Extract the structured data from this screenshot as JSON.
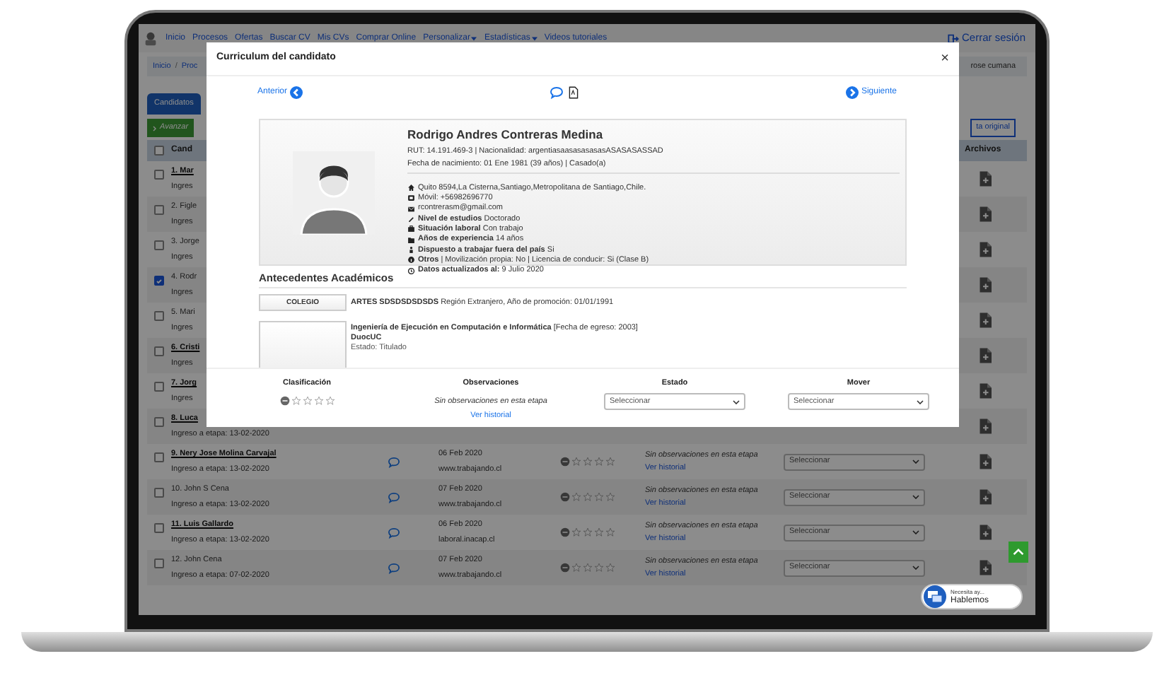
{
  "nav": {
    "items": [
      {
        "label": "Inicio",
        "caret": false
      },
      {
        "label": "Procesos",
        "caret": false
      },
      {
        "label": "Ofertas",
        "caret": false
      },
      {
        "label": "Buscar CV",
        "caret": false
      },
      {
        "label": "Mis CVs",
        "caret": false
      },
      {
        "label": "Comprar Online",
        "caret": false
      },
      {
        "label": "Personalizar",
        "caret": true
      },
      {
        "label": "Estadísticas",
        "caret": true
      },
      {
        "label": "Videos tutoriales",
        "caret": false
      }
    ],
    "logout": "Cerrar sesión"
  },
  "breadcrumb": {
    "items": [
      "Inicio",
      "Proc"
    ],
    "separator": "/",
    "user": "rose cumana"
  },
  "tabs": [
    {
      "label": "Candidatos",
      "selected": true
    }
  ],
  "advance_button": "Avanzar",
  "view_button": "ta original",
  "table": {
    "columns": [
      "Cand",
      "Archivos"
    ],
    "header_checked": false,
    "rows": [
      {
        "name": "1. Mar",
        "emphasized": true,
        "checked": false,
        "entry": "Ingres"
      },
      {
        "name": "2. Figle",
        "emphasized": false,
        "checked": false,
        "entry": "Ingres"
      },
      {
        "name": "3. Jorge",
        "emphasized": false,
        "checked": false,
        "entry": "Ingres"
      },
      {
        "name": "4. Rodr",
        "emphasized": false,
        "checked": true,
        "entry": "Ingres"
      },
      {
        "name": "5. Mari",
        "emphasized": false,
        "checked": false,
        "entry": "Ingres"
      },
      {
        "name": "6. Cristi",
        "emphasized": true,
        "checked": false,
        "entry": "Ingres"
      },
      {
        "name": "7. Jorg",
        "emphasized": true,
        "checked": false,
        "entry": "Ingres"
      },
      {
        "name": "8. Luca",
        "emphasized": true,
        "checked": false,
        "entry": "Ingreso a etapa: 13-02-2020"
      },
      {
        "name": "9. Nery Jose Molina Carvajal",
        "emphasized": true,
        "checked": false,
        "entry": "Ingreso a etapa: 13-02-2020",
        "date": "06 Feb 2020",
        "site": "www.trabajando.cl",
        "stars": 0,
        "observation": "Sin observaciones en esta etapa",
        "history_link": "Ver historial",
        "status": "Seleccionar"
      },
      {
        "name": "10. John S Cena",
        "emphasized": false,
        "checked": false,
        "entry": "Ingreso a etapa: 13-02-2020",
        "date": "07 Feb 2020",
        "site": "www.trabajando.cl",
        "stars": 0,
        "observation": "Sin observaciones en esta etapa",
        "history_link": "Ver historial",
        "status": "Seleccionar"
      },
      {
        "name": "11. Luis Gallardo",
        "emphasized": true,
        "checked": false,
        "entry": "Ingreso a etapa: 13-02-2020",
        "date": "06 Feb 2020",
        "site": "laboral.inacap.cl",
        "stars": 0,
        "observation": "Sin observaciones en esta etapa",
        "history_link": "Ver historial",
        "status": "Seleccionar"
      },
      {
        "name": "12. John Cena",
        "emphasized": false,
        "checked": false,
        "entry": "Ingreso a etapa: 07-02-2020",
        "date": "07 Feb 2020",
        "site": "www.trabajando.cl",
        "stars": 0,
        "observation": "Sin observaciones en esta etapa",
        "history_link": "Ver historial",
        "status": "Seleccionar"
      }
    ]
  },
  "modal": {
    "title": "Curriculum del candidato",
    "close": "×",
    "prev": "Anterior",
    "next": "Siguiente",
    "profile": {
      "name": "Rodrigo Andres Contreras Medina",
      "id_line": "RUT: 14.191.469-3 | Nacionalidad: argentiasaasasasasasASASASASSAD",
      "birth_line": "Fecha de nacimiento: 01 Ene 1981 (39 años) | Casado(a)",
      "details": [
        {
          "kind": "address",
          "text": "Quito 8594,La Cisterna,Santiago,Metropolitana de Santiago,Chile."
        },
        {
          "kind": "phone",
          "text": "Móvil: +56982696770"
        },
        {
          "kind": "email",
          "text": "rcontrerasm@gmail.com"
        },
        {
          "kind": "education",
          "text": "**Nivel de estudios** Doctorado"
        },
        {
          "kind": "work",
          "text": "**Situación laboral** Con trabajo"
        },
        {
          "kind": "experience",
          "text": "**Años de experiencia** 14 años"
        },
        {
          "kind": "relocation",
          "text": "**Dispuesto a trabajar fuera del país** Si"
        },
        {
          "kind": "other",
          "text": "**Otros**  | Movilización propia: No | Licencia de conducir: Si (Clase B)"
        },
        {
          "kind": "updated",
          "text": "**Datos actualizados al:**  9 Julio 2020"
        }
      ]
    },
    "academic": {
      "title": "Antecedentes Académicos",
      "entries": [
        {
          "label": "COLEGIO",
          "title": "**ARTES SDSDSDSDSDS** Región Extranjero, Año de promoción: 01/01/1991"
        },
        {
          "title": "**Ingeniería de Ejecución en Computación e Informática**  [Fecha de egreso: 2003]",
          "institution": "DuocUC",
          "status": "Estado: Titulado"
        }
      ]
    },
    "footer": {
      "rating_label": "Clasificación",
      "stars": 0,
      "observations_label": "Observaciones",
      "observation": "Sin observaciones en esta etapa",
      "history_link": "Ver historial",
      "status_label": "Estado",
      "status_value": "Seleccionar",
      "move_label": "Mover",
      "move_value": "Seleccionar"
    }
  },
  "chat_widget": {
    "prompt": "Necesita ay...",
    "action": "Hablemos"
  }
}
